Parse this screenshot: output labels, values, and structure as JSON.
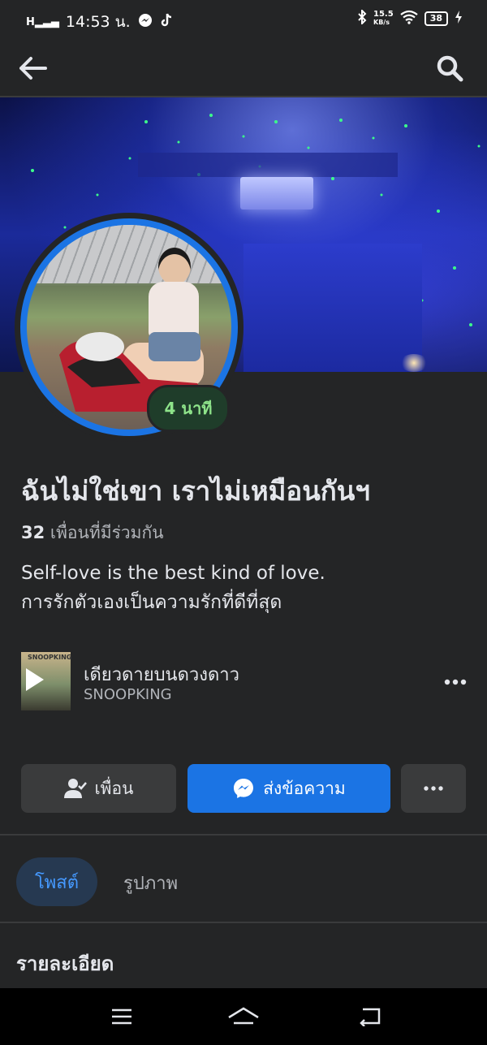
{
  "status_bar": {
    "signal": "H",
    "time": "14:53 น.",
    "network_speed": "15.5",
    "network_unit": "KB/s",
    "battery": "38"
  },
  "profile": {
    "name": "ฉันไม่ใช่เขา เราไม่เหมือนกันฯ",
    "mutual_count": "32",
    "mutual_label": " เพื่อนที่มีร่วมกัน",
    "bio_line1": "Self-love is the best kind of love.",
    "bio_line2": "การรักตัวเองเป็นความรักที่ดีที่สุด",
    "story_time": "4 นาที"
  },
  "music": {
    "album_text": "SNOOPKING",
    "song": "เดียวดายบนดวงดาว",
    "artist": "SNOOPKING"
  },
  "actions": {
    "friend_label": "เพื่อน",
    "message_label": "ส่งข้อความ"
  },
  "tabs": [
    {
      "label": "โพสต์"
    },
    {
      "label": "รูปภาพ"
    }
  ],
  "section": {
    "details_title": "รายละเอียด"
  },
  "colors": {
    "background": "#242526",
    "accent_blue": "#1b74e4",
    "story_green": "#8ee38a"
  }
}
